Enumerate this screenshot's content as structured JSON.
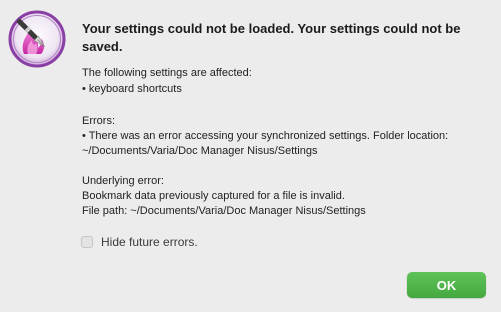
{
  "dialog": {
    "title": "Your settings could not be loaded. Your settings could not be saved.",
    "affected_heading": "The following settings are affected:",
    "affected_item": "• keyboard shortcuts",
    "errors_heading": "Errors:",
    "error_line1": "• There was an error accessing your synchronized settings. Folder location:",
    "error_line2": "~/Documents/Varia/Doc Manager Nisus/Settings",
    "underlying_heading": "Underlying error:",
    "underlying_line1": "Bookmark data previously captured for a file is invalid.",
    "underlying_line2": "File path: ~/Documents/Varia/Doc Manager Nisus/Settings",
    "checkbox_label": "Hide future errors.",
    "checkbox_checked": false,
    "ok_label": "OK"
  },
  "colors": {
    "ok_button": "#4cb247",
    "icon_ring": "#8a3fa5",
    "icon_flame": "#d43db6"
  },
  "icons": {
    "app": "nisus-writer-pen-icon"
  }
}
